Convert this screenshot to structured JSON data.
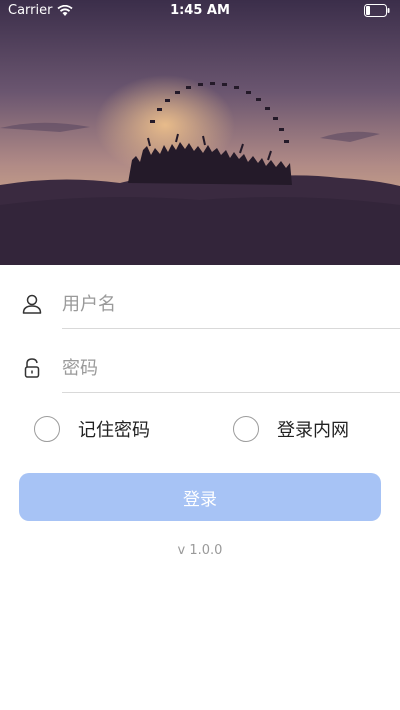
{
  "status_bar": {
    "carrier": "Carrier",
    "time": "1:45 AM"
  },
  "login_form": {
    "username_placeholder": "用户名",
    "password_placeholder": "密码",
    "remember_password_label": "记住密码",
    "intranet_login_label": "登录内网",
    "login_button_label": "登录",
    "version": "v 1.0.0"
  },
  "icons": {
    "username": "user-icon",
    "password": "lock-icon",
    "signal": "wifi-icon",
    "battery": "battery-icon"
  },
  "colors": {
    "login_button": "#a7c3f5",
    "hero_sky_top": "#3d2f4c",
    "hero_sky_horizon": "#b08a86"
  }
}
